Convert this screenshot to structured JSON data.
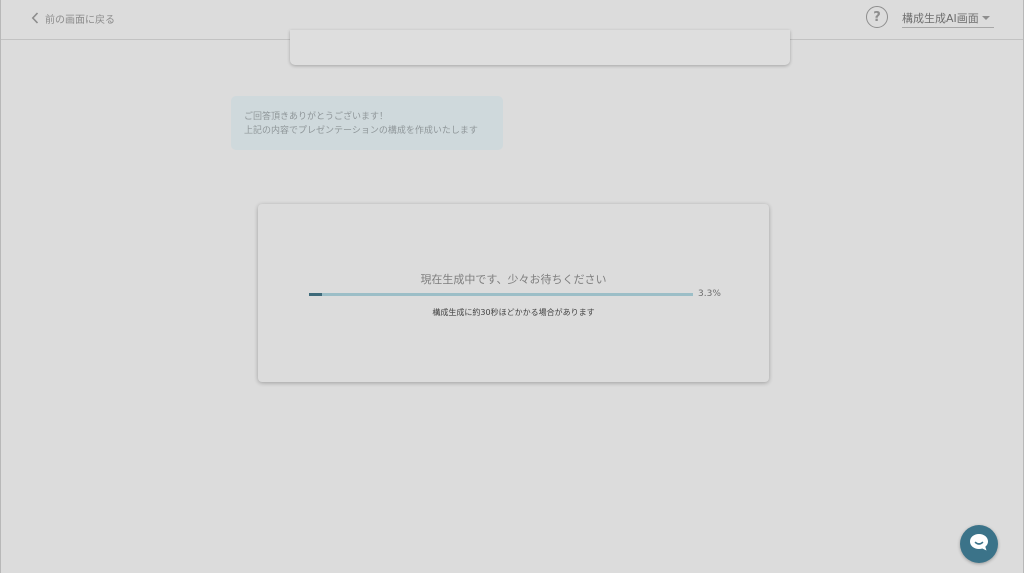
{
  "header": {
    "back_label": "前の画面に戻る",
    "help_icon_glyph": "?",
    "mode_select_value": "構成生成AI画面"
  },
  "bubble": {
    "line1": "ご回答頂きありがとうございます！",
    "line2": "上記の内容でプレゼンテーションの構成を作成いたします"
  },
  "progress": {
    "title": "現在生成中です、少々お待ちください",
    "percent_label": "3.3%",
    "value_percent": 3.3,
    "note": "構成生成に約30秒ほどかかる場合があります"
  },
  "icons": {
    "back": "chevron-left-icon",
    "help": "help-circle-icon",
    "select_caret": "caret-down-icon",
    "chat": "chat-icon"
  },
  "colors": {
    "background": "#dcdcdc",
    "progress_fill": "#3e6a7a",
    "progress_track": "#9cbec7",
    "chat_button": "#3b7389",
    "bubble": "#cfd9dc"
  }
}
